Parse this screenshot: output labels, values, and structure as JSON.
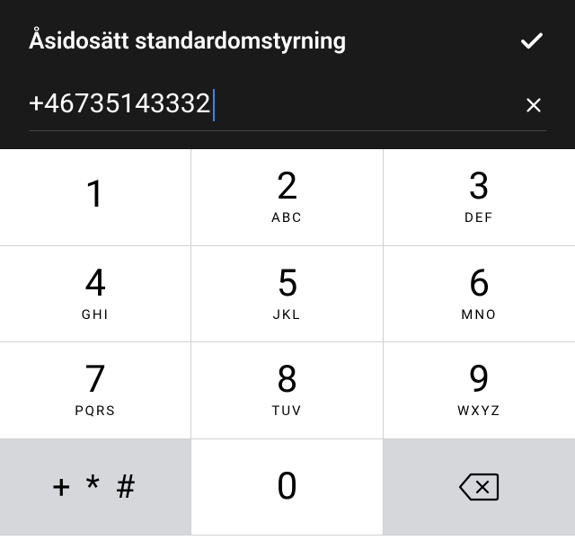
{
  "header": {
    "title": "Åsidosätt standardomstyrning",
    "phone_value": "+46735143332"
  },
  "keypad": {
    "keys": [
      {
        "digit": "1",
        "letters": ""
      },
      {
        "digit": "2",
        "letters": "ABC"
      },
      {
        "digit": "3",
        "letters": "DEF"
      },
      {
        "digit": "4",
        "letters": "GHI"
      },
      {
        "digit": "5",
        "letters": "JKL"
      },
      {
        "digit": "6",
        "letters": "MNO"
      },
      {
        "digit": "7",
        "letters": "PQRS"
      },
      {
        "digit": "8",
        "letters": "TUV"
      },
      {
        "digit": "9",
        "letters": "WXYZ"
      }
    ],
    "symbols": "+ * #",
    "zero": "0"
  }
}
